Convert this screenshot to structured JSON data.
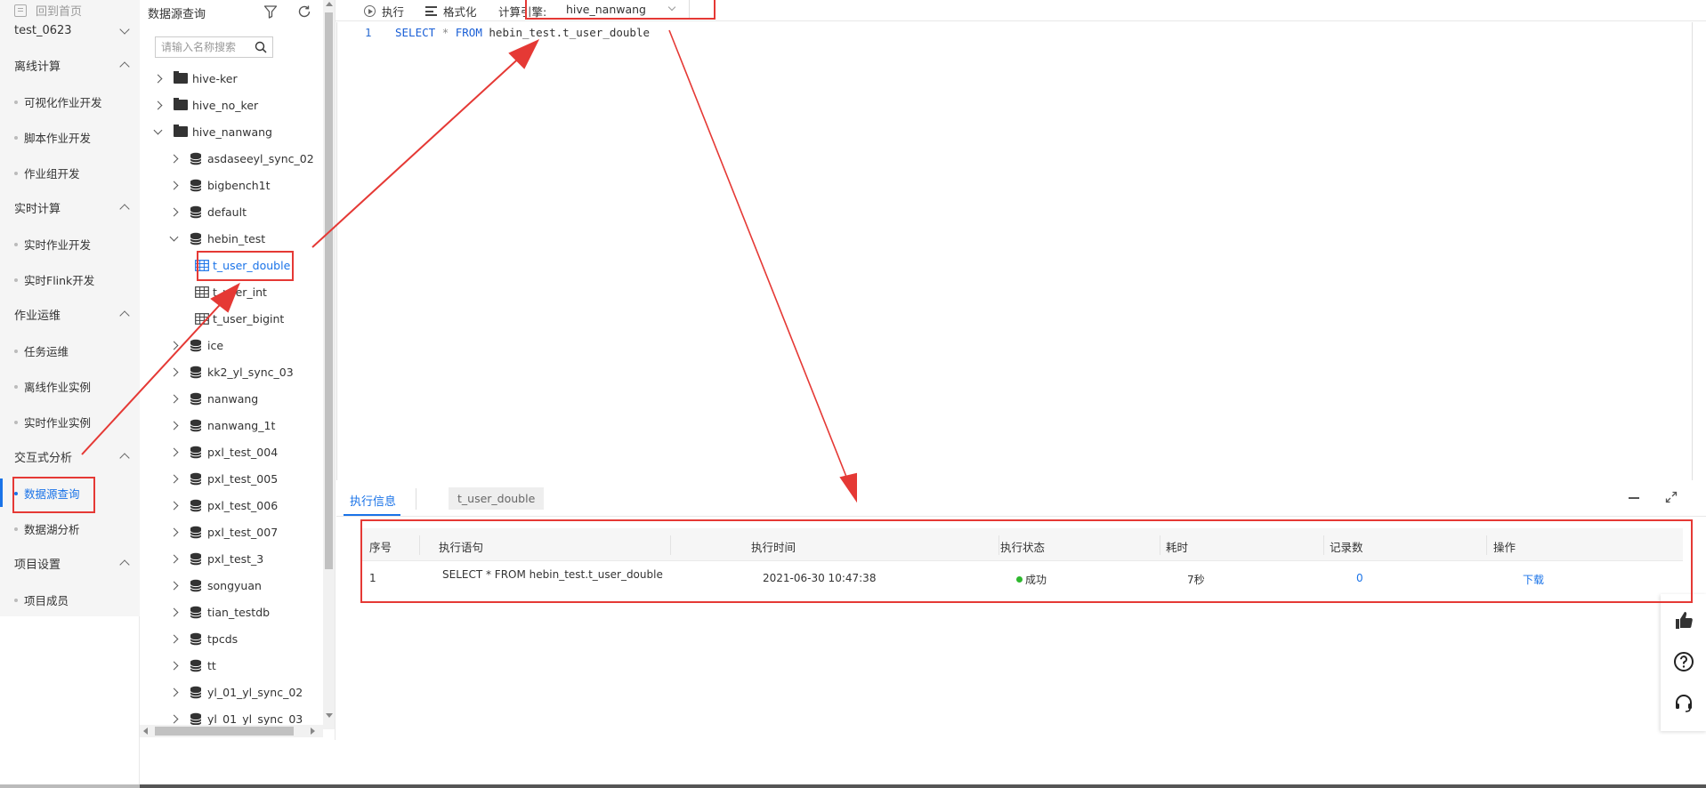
{
  "nav": {
    "home_label": "回到首页",
    "project": "test_0623",
    "sections": [
      {
        "title": "离线计算",
        "items": [
          "可视化作业开发",
          "脚本作业开发",
          "作业组开发"
        ]
      },
      {
        "title": "实时计算",
        "items": [
          "实时作业开发",
          "实时Flink开发"
        ]
      },
      {
        "title": "作业运维",
        "items": [
          "任务运维",
          "离线作业实例",
          "实时作业实例"
        ]
      },
      {
        "title": "交互式分析",
        "items": [
          "数据源查询",
          "数据湖分析"
        ]
      },
      {
        "title": "项目设置",
        "items": [
          "项目成员"
        ]
      }
    ],
    "active_item": "数据源查询"
  },
  "tree": {
    "title": "数据源查询",
    "search_placeholder": "请输入名称搜索",
    "nodes": [
      {
        "label": "hive-ker",
        "type": "folder",
        "expanded": false,
        "level": 0
      },
      {
        "label": "hive_no_ker",
        "type": "folder",
        "expanded": false,
        "level": 0
      },
      {
        "label": "hive_nanwang",
        "type": "folder",
        "expanded": true,
        "level": 0
      },
      {
        "label": "asdaseeyl_sync_02",
        "type": "db",
        "expanded": false,
        "level": 1
      },
      {
        "label": "bigbench1t",
        "type": "db",
        "expanded": false,
        "level": 1
      },
      {
        "label": "default",
        "type": "db",
        "expanded": false,
        "level": 1
      },
      {
        "label": "hebin_test",
        "type": "db",
        "expanded": true,
        "level": 1
      },
      {
        "label": "t_user_double",
        "type": "table",
        "level": 2,
        "selected": true
      },
      {
        "label": "t_user_int",
        "type": "table",
        "level": 2
      },
      {
        "label": "t_user_bigint",
        "type": "table",
        "level": 2
      },
      {
        "label": "ice",
        "type": "db",
        "expanded": false,
        "level": 1
      },
      {
        "label": "kk2_yl_sync_03",
        "type": "db",
        "expanded": false,
        "level": 1
      },
      {
        "label": "nanwang",
        "type": "db",
        "expanded": false,
        "level": 1
      },
      {
        "label": "nanwang_1t",
        "type": "db",
        "expanded": false,
        "level": 1
      },
      {
        "label": "pxl_test_004",
        "type": "db",
        "expanded": false,
        "level": 1
      },
      {
        "label": "pxl_test_005",
        "type": "db",
        "expanded": false,
        "level": 1
      },
      {
        "label": "pxl_test_006",
        "type": "db",
        "expanded": false,
        "level": 1
      },
      {
        "label": "pxl_test_007",
        "type": "db",
        "expanded": false,
        "level": 1
      },
      {
        "label": "pxl_test_3",
        "type": "db",
        "expanded": false,
        "level": 1
      },
      {
        "label": "songyuan",
        "type": "db",
        "expanded": false,
        "level": 1
      },
      {
        "label": "tian_testdb",
        "type": "db",
        "expanded": false,
        "level": 1
      },
      {
        "label": "tpcds",
        "type": "db",
        "expanded": false,
        "level": 1
      },
      {
        "label": "tt",
        "type": "db",
        "expanded": false,
        "level": 1
      },
      {
        "label": "yl_01_yl_sync_02",
        "type": "db",
        "expanded": false,
        "level": 1
      },
      {
        "label": "yl_01_yl_sync_03",
        "type": "db",
        "expanded": false,
        "level": 1
      }
    ]
  },
  "toolbar": {
    "run_label": "执行",
    "format_label": "格式化",
    "engine_label": "计算引擎:",
    "engine_value": "hive_nanwang"
  },
  "editor": {
    "line_number": "1",
    "kw_select": "SELECT",
    "star": "*",
    "kw_from": "FROM",
    "table_ref": "hebin_test.t_user_double"
  },
  "results": {
    "tab_info": "执行信息",
    "tab_table": "t_user_double",
    "columns": [
      "序号",
      "执行语句",
      "执行时间",
      "执行状态",
      "耗时",
      "记录数",
      "操作"
    ],
    "rows": [
      {
        "seq": "1",
        "statement": "SELECT * FROM hebin_test.t_user_double",
        "time": "2021-06-30 10:47:38",
        "status": "成功",
        "duration": "7秒",
        "records": "0",
        "action": "下载"
      }
    ]
  },
  "colors": {
    "accent": "#1a73e8",
    "annotation": "#e53935",
    "success": "#2eb82e"
  }
}
